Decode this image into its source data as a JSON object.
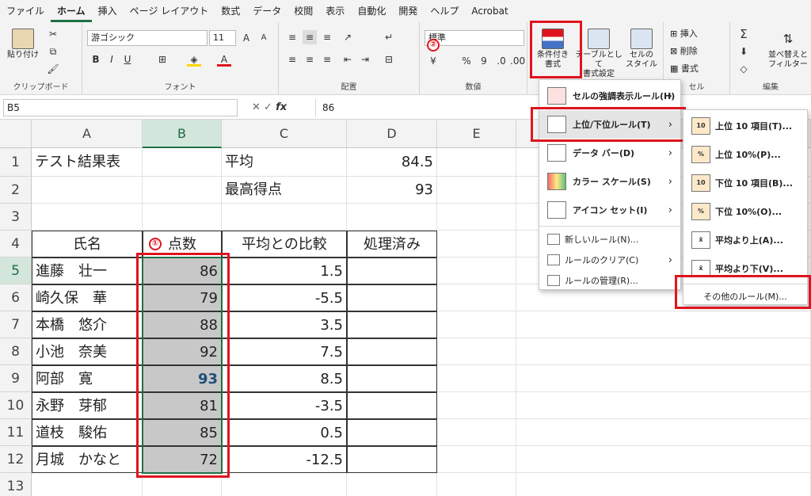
{
  "menubar": {
    "tabs": [
      "ファイル",
      "ホーム",
      "挿入",
      "ページ レイアウト",
      "数式",
      "データ",
      "校閲",
      "表示",
      "自動化",
      "開発",
      "ヘルプ",
      "Acrobat"
    ],
    "active_index": 1
  },
  "ribbon": {
    "clipboard": {
      "paste_label": "貼り付け",
      "group_label": "クリップボード"
    },
    "font": {
      "font_name": "游ゴシック",
      "font_size": "11",
      "group_label": "フォント"
    },
    "alignment": {
      "group_label": "配置"
    },
    "number": {
      "format_value": "標準",
      "group_label": "数値"
    },
    "styles": {
      "conditional_label_1": "条件付き",
      "conditional_label_2": "書式",
      "table_label_1": "テーブルとして",
      "table_label_2": "書式設定",
      "cell_style_label_1": "セルの",
      "cell_style_label_2": "スタイル"
    },
    "cells": {
      "insert_label": "挿入",
      "delete_label": "削除",
      "format_label": "書式",
      "group_label": "セル"
    },
    "editing": {
      "sort_label_1": "並べ替えと",
      "sort_label_2": "フィルター",
      "group_label": "編集"
    }
  },
  "annotations": {
    "circle_1": "①",
    "circle_2": "②"
  },
  "formula_bar": {
    "name_box": "B5",
    "fx_label": "fx",
    "value": "86"
  },
  "grid": {
    "columns": [
      "A",
      "B",
      "C",
      "D",
      "E"
    ],
    "rows": [
      "1",
      "2",
      "3",
      "4",
      "5",
      "6",
      "7",
      "8",
      "9",
      "10",
      "11",
      "12",
      "13"
    ],
    "summary": {
      "title": "テスト結果表",
      "avg_label": "平均",
      "avg_value": "84.5",
      "max_label": "最高得点",
      "max_value": "93"
    },
    "headers": {
      "name": "氏名",
      "score": "点数",
      "diff": "平均との比較",
      "done": "処理済み"
    },
    "records": [
      {
        "name": "進藤　壮一",
        "score": "86",
        "diff": "1.5"
      },
      {
        "name": "崎久保　華",
        "score": "79",
        "diff": "-5.5"
      },
      {
        "name": "本橋　悠介",
        "score": "88",
        "diff": "3.5"
      },
      {
        "name": "小池　奈美",
        "score": "92",
        "diff": "7.5"
      },
      {
        "name": "阿部　寛",
        "score": "93",
        "diff": "8.5"
      },
      {
        "name": "永野　芽郁",
        "score": "81",
        "diff": "-3.5"
      },
      {
        "name": "道枝　駿佑",
        "score": "85",
        "diff": "0.5"
      },
      {
        "name": "月城　かなと",
        "score": "72",
        "diff": "-12.5"
      }
    ]
  },
  "cf_menu": {
    "items": [
      {
        "label": "セルの強調表示ルール(H)",
        "icon": "highlight-rules-icon"
      },
      {
        "label": "上位/下位ルール(T)",
        "icon": "top-bottom-rules-icon"
      },
      {
        "label": "データ バー(D)",
        "icon": "data-bars-icon"
      },
      {
        "label": "カラー スケール(S)",
        "icon": "color-scales-icon"
      },
      {
        "label": "アイコン セット(I)",
        "icon": "icon-sets-icon"
      }
    ],
    "small_items": [
      {
        "label": "新しいルール(N)...",
        "icon": "new-rule-icon"
      },
      {
        "label": "ルールのクリア(C)",
        "icon": "clear-rules-icon"
      },
      {
        "label": "ルールの管理(R)...",
        "icon": "manage-rules-icon"
      }
    ]
  },
  "submenu": {
    "items": [
      {
        "label": "上位 10 項目(T)...",
        "icon_text": "10"
      },
      {
        "label": "上位 10%(P)...",
        "icon_text": "%"
      },
      {
        "label": "下位 10 項目(B)...",
        "icon_text": "10"
      },
      {
        "label": "下位 10%(O)...",
        "icon_text": "%"
      },
      {
        "label": "平均より上(A)...",
        "icon_text": "x̄"
      },
      {
        "label": "平均より下(V)...",
        "icon_text": "x̄"
      }
    ],
    "more_rules": "その他のルール(M)..."
  },
  "colors": {
    "accent": "#1e7145",
    "selection": "#d3e6db",
    "highlight_red": "#e0141e",
    "bold_blue": "#1f4e79",
    "grey_fill": "#c8c8c8"
  }
}
